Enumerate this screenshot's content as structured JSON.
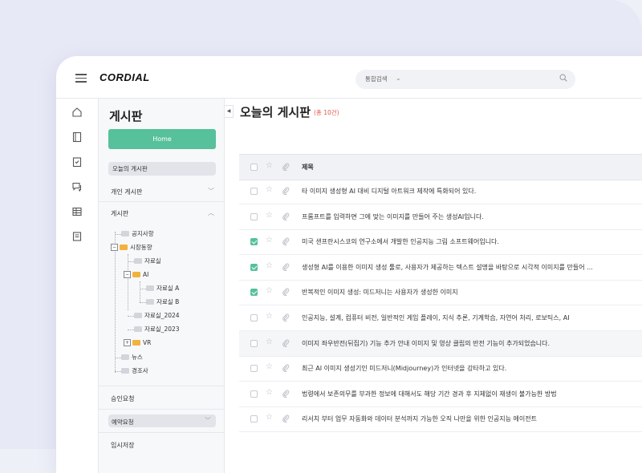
{
  "app": {
    "logo": "CORDIAL"
  },
  "search": {
    "scope": "통합검색"
  },
  "sidebar": {
    "title": "게시판",
    "home_label": "Home",
    "today_label": "오늘의 게시판",
    "personal_label": "개인 게시판",
    "board_label": "게시판",
    "tree": [
      {
        "label": "공지사항",
        "type": "file"
      },
      {
        "label": "시장동향",
        "type": "folder",
        "state": "expanded"
      },
      {
        "label": "자료실",
        "type": "file"
      },
      {
        "label": "AI",
        "type": "folder",
        "state": "expanded"
      },
      {
        "label": "자료실 A",
        "type": "file"
      },
      {
        "label": "자료실 B",
        "type": "file"
      },
      {
        "label": "자료실_2024",
        "type": "file"
      },
      {
        "label": "자료실_2023",
        "type": "file"
      },
      {
        "label": "VR",
        "type": "folder",
        "state": "collapsed"
      },
      {
        "label": "뉴스",
        "type": "file"
      },
      {
        "label": "경조사",
        "type": "file"
      }
    ],
    "approval_label": "승인요청",
    "reserve_label": "예약요청",
    "draft_label": "임시저장"
  },
  "main": {
    "title": "오늘의 게시판",
    "count": "(총 10건)",
    "header_subject": "제목",
    "rows": [
      {
        "subject": "타 이미지 생성형 AI 대비 디지털 아트워크 제작에 특화되어 있다.",
        "checked": false
      },
      {
        "subject": "프롬프트를 입력하면 그에 맞는 이미지를 만들어 주는 생성AI입니다.",
        "checked": false
      },
      {
        "subject": "미국 샌프란시스코의 연구소에서 개발한 인공지능 그림 소프트웨어입니다.",
        "checked": true
      },
      {
        "subject": "생성형 AI를 이용한 이미지 생성 툴로, 사용자가 제공하는 텍스트 설명을 바탕으로 시각적 이미지를 만들어 ...",
        "checked": true
      },
      {
        "subject": "반복적인 이미지 생성: 미드저니는 사용자가 생성한 이미지",
        "checked": true
      },
      {
        "subject": "인공지능, 설계, 컴퓨터 비전, 일반적인 게임 플레이, 지식 추론, 기계학습, 자연어 처리, 로보틱스, AI",
        "checked": false
      },
      {
        "subject": "이미지 좌우반전(뒤집기) 기능 추가 안내 이미지 및 영상 클립의 반전 기능이 추가되었습니다.",
        "checked": false
      },
      {
        "subject": "최근 AI 이미지 생성기인 미드저니(Midjourney)가 인터넷을 강타하고 있다.",
        "checked": false
      },
      {
        "subject": "법령에서 보존의무를 부과한 정보에 대해서도 해당 기간 경과 후 지체없이 재생이 불가능한 방법",
        "checked": false
      },
      {
        "subject": "리서치 부터 업무 자동화와 데이터 분석까지 가능한 오직 나만을 위한 인공지능 에이전트",
        "checked": false
      }
    ]
  },
  "colors": {
    "accent": "#56c19a",
    "count": "#e2574c",
    "folder": "#f2b23f"
  }
}
